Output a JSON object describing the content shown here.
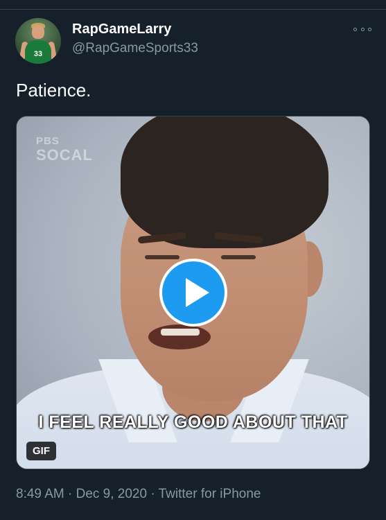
{
  "tweet": {
    "display_name": "RapGameLarry",
    "handle": "@RapGameSports33",
    "text": "Patience.",
    "avatar_jersey_number": "33",
    "more_icon": "more-horizontal-icon",
    "media": {
      "type": "GIF",
      "badge": "GIF",
      "watermark_line1": "PBS",
      "watermark_line2": "SOCAL",
      "caption": "I FEEL REALLY GOOD ABOUT THAT",
      "play_icon": "play-icon",
      "accent": "#1d9bf0"
    },
    "time": "8:49 AM",
    "date": "Dec 9, 2020",
    "separator": "·",
    "source": "Twitter for iPhone"
  },
  "colors": {
    "background": "#15202b",
    "secondary_text": "#8899a6",
    "divider": "#38444d"
  }
}
